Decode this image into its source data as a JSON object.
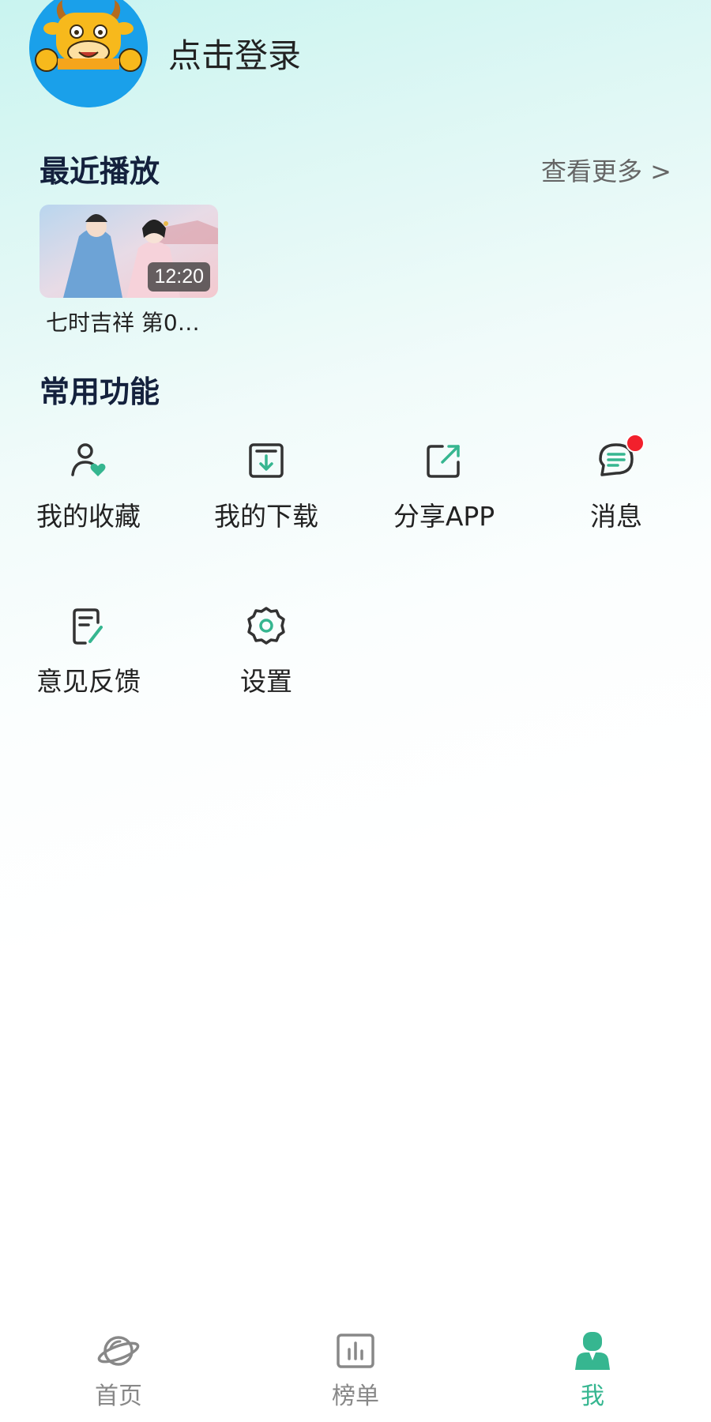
{
  "header": {
    "login_text": "点击登录"
  },
  "recent": {
    "title": "最近播放",
    "view_more": "查看更多 >",
    "items": [
      {
        "title": "七时吉祥 第0…",
        "duration": "12:20"
      }
    ]
  },
  "functions": {
    "title": "常用功能",
    "items": [
      {
        "label": "我的收藏",
        "icon": "user-heart-icon"
      },
      {
        "label": "我的下载",
        "icon": "download-icon"
      },
      {
        "label": "分享APP",
        "icon": "share-icon"
      },
      {
        "label": "消息",
        "icon": "message-icon",
        "has_badge": true
      },
      {
        "label": "意见反馈",
        "icon": "feedback-icon"
      },
      {
        "label": "设置",
        "icon": "settings-icon"
      }
    ]
  },
  "bottom_nav": {
    "items": [
      {
        "label": "首页",
        "icon": "planet-icon",
        "active": false
      },
      {
        "label": "榜单",
        "icon": "chart-icon",
        "active": false
      },
      {
        "label": "我",
        "icon": "person-icon",
        "active": true
      }
    ]
  },
  "colors": {
    "accent": "#36b690",
    "badge": "#f2202c",
    "avatar_bg": "#1aa0ea",
    "title": "#14213d"
  }
}
